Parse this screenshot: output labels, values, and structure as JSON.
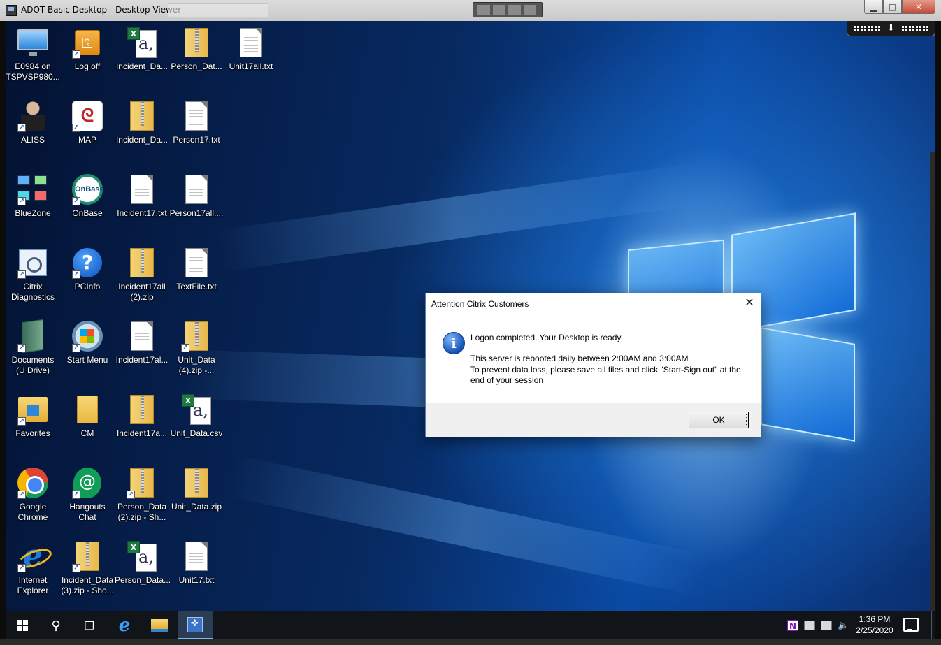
{
  "viewer": {
    "title": "ADOT Basic Desktop - Desktop Viewer",
    "minimize_glyph": "▁",
    "maximize_glyph": "□",
    "close_glyph": "✕",
    "toolbar_arrow_glyph": "⬇"
  },
  "desktop": {
    "icons": [
      {
        "label": "E0984 on\nTSPVSP980...",
        "icon": "monitor-icon",
        "shortcut": false
      },
      {
        "label": "Log off",
        "icon": "logoff-key-icon",
        "shortcut": true
      },
      {
        "label": "Incident_Da...",
        "icon": "excel-csv-icon",
        "shortcut": false
      },
      {
        "label": "Person_Dat...",
        "icon": "zip-folder-icon",
        "shortcut": false
      },
      {
        "label": "Unit17all.txt",
        "icon": "text-file-icon",
        "shortcut": false
      },
      {
        "label": "ALISS",
        "icon": "person-icon",
        "shortcut": true
      },
      {
        "label": "MAP",
        "icon": "map-app-icon",
        "shortcut": true
      },
      {
        "label": "Incident_Da...",
        "icon": "zip-folder-icon",
        "shortcut": false
      },
      {
        "label": "Person17.txt",
        "icon": "text-file-icon",
        "shortcut": false
      },
      {
        "label": "BlueZone",
        "icon": "bluezone-icon",
        "shortcut": true
      },
      {
        "label": "OnBase",
        "icon": "onbase-icon",
        "shortcut": true
      },
      {
        "label": "Incident17.txt",
        "icon": "text-file-icon",
        "shortcut": false
      },
      {
        "label": "Person17all....",
        "icon": "text-file-icon",
        "shortcut": false
      },
      {
        "label": "Citrix\nDiagnostics",
        "icon": "citrix-diagnostics-icon",
        "shortcut": true
      },
      {
        "label": "PCInfo",
        "icon": "help-icon",
        "shortcut": true
      },
      {
        "label": "Incident17all\n(2).zip",
        "icon": "zip-folder-icon",
        "shortcut": false
      },
      {
        "label": "TextFile.txt",
        "icon": "text-file-icon",
        "shortcut": false
      },
      {
        "label": "Documents\n(U Drive)",
        "icon": "documents-icon",
        "shortcut": true
      },
      {
        "label": "Start Menu",
        "icon": "start-menu-icon",
        "shortcut": true
      },
      {
        "label": "Incident17al...",
        "icon": "text-file-icon",
        "shortcut": false
      },
      {
        "label": "Unit_Data\n(4).zip -...",
        "icon": "zip-folder-icon",
        "shortcut": true
      },
      {
        "label": "Favorites",
        "icon": "favorites-icon",
        "shortcut": true
      },
      {
        "label": "CM",
        "icon": "folder-icon",
        "shortcut": false
      },
      {
        "label": "Incident17a...",
        "icon": "zip-folder-icon",
        "shortcut": false
      },
      {
        "label": "Unit_Data.csv",
        "icon": "excel-csv-icon",
        "shortcut": false
      },
      {
        "label": "Google\nChrome",
        "icon": "chrome-icon",
        "shortcut": true
      },
      {
        "label": "Hangouts\nChat",
        "icon": "hangouts-icon",
        "shortcut": true
      },
      {
        "label": "Person_Data\n(2).zip - Sh...",
        "icon": "zip-folder-icon",
        "shortcut": true
      },
      {
        "label": "Unit_Data.zip",
        "icon": "zip-folder-icon",
        "shortcut": false
      },
      {
        "label": "Internet\nExplorer",
        "icon": "internet-explorer-icon",
        "shortcut": true
      },
      {
        "label": "Incident_Data\n(3).zip - Sho...",
        "icon": "zip-folder-icon",
        "shortcut": true
      },
      {
        "label": "Person_Data...",
        "icon": "excel-csv-icon",
        "shortcut": false
      },
      {
        "label": "Unit17.txt",
        "icon": "text-file-icon",
        "shortcut": false
      }
    ]
  },
  "dialog": {
    "title": "Attention Citrix Customers",
    "close_glyph": "✕",
    "info_glyph": "i",
    "heading": "Logon completed. Your Desktop is ready",
    "line1": "This server is rebooted daily between 2:00AM and 3:00AM",
    "line2": "To prevent data loss, please save all files and click \"Start-Sign out\" at the end of your session",
    "ok_label": "OK"
  },
  "taskbar": {
    "search_glyph": "⚲",
    "taskview_glyph": "❐",
    "ie_glyph": "e",
    "tray_onenote": "N",
    "volume_glyph": "🔈",
    "time": "1:36 PM",
    "date": "2/25/2020"
  }
}
